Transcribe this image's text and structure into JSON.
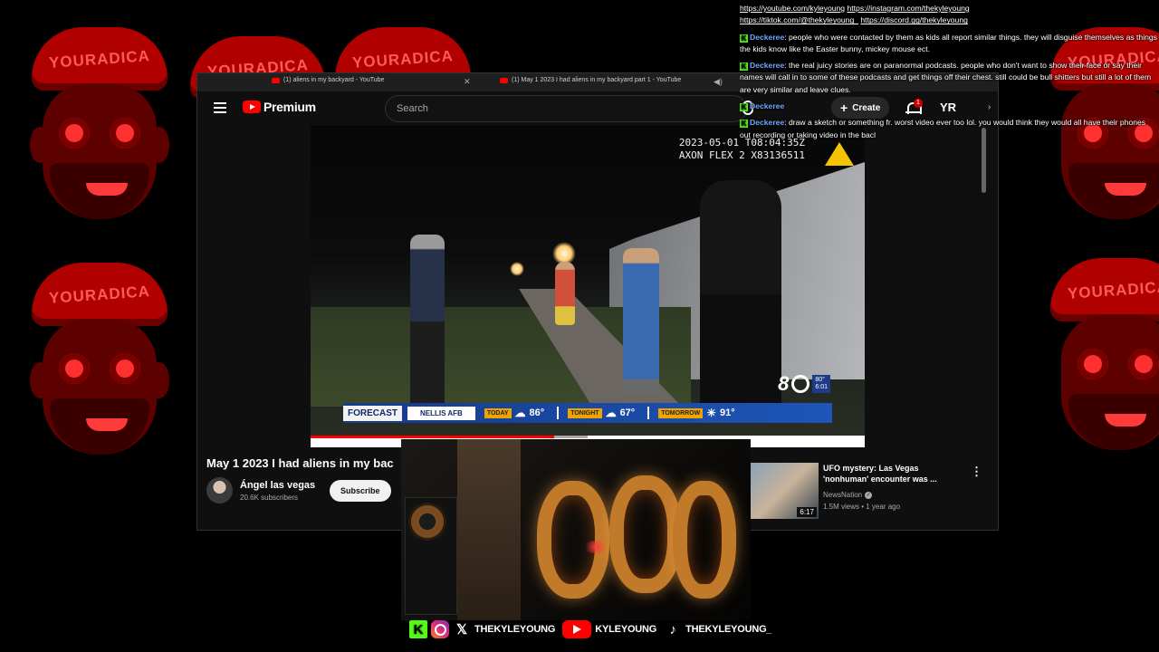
{
  "background": {
    "mascot_cap_text": "YOURADICA",
    "accent_color": "#cc0000"
  },
  "browser": {
    "tabs": [
      {
        "title": "(1) aliens in my backyard - YouTube",
        "icon": "youtube-icon"
      },
      {
        "title": "(1) May 1 2023 I had aliens in my backyard part 1 - YouTube",
        "icon": "youtube-icon"
      }
    ]
  },
  "youtube": {
    "logo_text": "Premium",
    "search_placeholder": "Search",
    "create_label": "Create",
    "notification_count": "1",
    "avatar_initials": "YR",
    "video": {
      "timestamp_overlay": "2023-05-01 T08:04:35Z",
      "camera_overlay": "AXON FLEX 2 X83136511",
      "progress_fraction": 0.44,
      "buffer_fraction": 0.5,
      "channel_bug_number": "8",
      "channel_bug_temp": "80°",
      "channel_bug_time": "6:01",
      "forecast": {
        "label": "FORECAST",
        "location": "NELLIS AFB",
        "today_label": "TODAY",
        "today_temp": "86°",
        "tonight_label": "TONIGHT",
        "tonight_temp": "67°",
        "tomorrow_label": "TOMORROW",
        "tomorrow_temp": "91°"
      }
    },
    "title": "May 1 2023 I had aliens in my bac",
    "channel_name": "Ángel las vegas",
    "channel_subs": "20.6K subscribers",
    "subscribe_label": "Subscribe",
    "recommendation": {
      "title": "UFO mystery: Las Vegas 'nonhuman' encounter was ...",
      "channel": "NewsNation",
      "meta": "1.5M views • 1 year ago",
      "duration": "6:17"
    }
  },
  "chat": {
    "links_line1": [
      "https://youtube.com/kyleyoung",
      "https://instagram.com/thekyleyoung"
    ],
    "links_line2": [
      "https://tiktok.com/@thekyleyoung_",
      "https://discord.gg/thekyleyoung"
    ],
    "messages": [
      {
        "user": "Deckeree",
        "text": "people who were contacted by them as kids all report similar things. they will disguise themselves as things the kids know like the Easter bunny, mickey mouse ect."
      },
      {
        "user": "Deckeree",
        "text": "the real juicy stories are on paranormal podcasts. people who don't want to show their face or say their names will call in to some of these podcasts and get things off their chest. still could be bull shitters but still a lot of them are very similar and leave clues."
      },
      {
        "user": "Deckeree",
        "text": ""
      },
      {
        "user": "Deckeree",
        "text": "draw a sketch or something fr. worst video ever too lol. you would think they would all have their phones out recording or taking video in the bacl"
      }
    ]
  },
  "socials": {
    "x_handle": "THEKYLEYOUNG",
    "youtube_handle": "KYLEYOUNG",
    "tiktok_handle": "THEKYLEYOUNG_"
  }
}
